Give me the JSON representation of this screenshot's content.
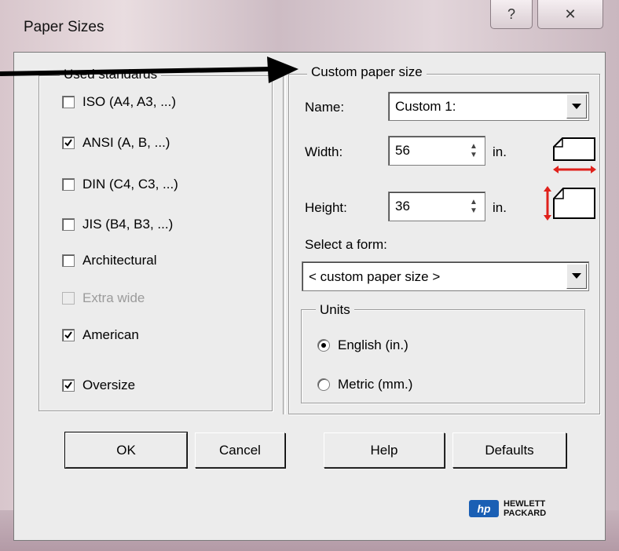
{
  "window": {
    "title": "Paper Sizes",
    "help_glyph": "?",
    "close_glyph": "✕"
  },
  "used_standards": {
    "legend": "Used standards",
    "items": [
      {
        "label": "ISO (A4, A3, ...)",
        "checked": false,
        "disabled": false
      },
      {
        "label": "ANSI (A, B, ...)",
        "checked": true,
        "disabled": false
      },
      {
        "label": "DIN (C4, C3, ...)",
        "checked": false,
        "disabled": false
      },
      {
        "label": "JIS (B4, B3, ...)",
        "checked": false,
        "disabled": false
      },
      {
        "label": "Architectural",
        "checked": false,
        "disabled": false
      },
      {
        "label": "Extra wide",
        "checked": false,
        "disabled": true
      },
      {
        "label": "American",
        "checked": true,
        "disabled": false
      },
      {
        "label": "Oversize",
        "checked": true,
        "disabled": false
      }
    ]
  },
  "custom": {
    "legend": "Custom paper size",
    "name_label": "Name:",
    "name_value": "Custom 1:",
    "width_label": "Width:",
    "width_value": "56",
    "height_label": "Height:",
    "height_value": "36",
    "unit": "in.",
    "form_label": "Select a form:",
    "form_value": "< custom paper size >"
  },
  "units": {
    "legend": "Units",
    "options": [
      {
        "label": "English (in.)",
        "selected": true
      },
      {
        "label": "Metric (mm.)",
        "selected": false
      }
    ]
  },
  "buttons": {
    "ok": "OK",
    "cancel": "Cancel",
    "help": "Help",
    "defaults": "Defaults"
  },
  "logo": {
    "line1": "HEWLETT",
    "line2": "PACKARD",
    "mark": "hp"
  },
  "colors": {
    "arrow_red": "#e0211b",
    "hp_blue": "#1a5fb4"
  }
}
